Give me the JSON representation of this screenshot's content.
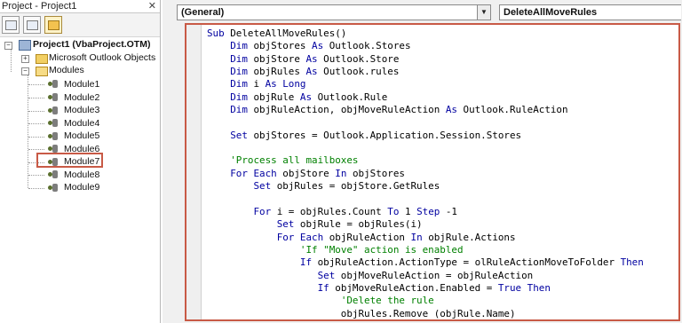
{
  "project_pane": {
    "title": "Project - Project1",
    "close": "✕",
    "toolbar_buttons": [
      "view-code-icon",
      "view-object-icon",
      "toggle-folders-icon"
    ],
    "tree": {
      "project": {
        "toggle": "−",
        "label": "Project1 (VbaProject.OTM)"
      },
      "outlook_objects": {
        "toggle": "+",
        "label": "Microsoft Outlook Objects"
      },
      "modules_folder": {
        "toggle": "−",
        "label": "Modules"
      },
      "modules": [
        "Module1",
        "Module2",
        "Module3",
        "Module4",
        "Module5",
        "Module6",
        "Module7",
        "Module8",
        "Module9"
      ],
      "selected_module": "Module7"
    }
  },
  "code_window": {
    "object_dropdown": "(General)",
    "procedure_dropdown": "DeleteAllMoveRules",
    "lines": [
      [
        [
          "kw",
          "Sub"
        ],
        [
          "t",
          " DeleteAllMoveRules()"
        ]
      ],
      [
        [
          "t",
          "    "
        ],
        [
          "kw",
          "Dim"
        ],
        [
          "t",
          " objStores "
        ],
        [
          "kw",
          "As"
        ],
        [
          "t",
          " Outlook.Stores"
        ]
      ],
      [
        [
          "t",
          "    "
        ],
        [
          "kw",
          "Dim"
        ],
        [
          "t",
          " objStore "
        ],
        [
          "kw",
          "As"
        ],
        [
          "t",
          " Outlook.Store"
        ]
      ],
      [
        [
          "t",
          "    "
        ],
        [
          "kw",
          "Dim"
        ],
        [
          "t",
          " objRules "
        ],
        [
          "kw",
          "As"
        ],
        [
          "t",
          " Outlook.rules"
        ]
      ],
      [
        [
          "t",
          "    "
        ],
        [
          "kw",
          "Dim"
        ],
        [
          "t",
          " i "
        ],
        [
          "kw",
          "As Long"
        ]
      ],
      [
        [
          "t",
          "    "
        ],
        [
          "kw",
          "Dim"
        ],
        [
          "t",
          " objRule "
        ],
        [
          "kw",
          "As"
        ],
        [
          "t",
          " Outlook.Rule"
        ]
      ],
      [
        [
          "t",
          "    "
        ],
        [
          "kw",
          "Dim"
        ],
        [
          "t",
          " objRuleAction, objMoveRuleAction "
        ],
        [
          "kw",
          "As"
        ],
        [
          "t",
          " Outlook.RuleAction"
        ]
      ],
      [
        [
          "t",
          ""
        ]
      ],
      [
        [
          "t",
          "    "
        ],
        [
          "kw",
          "Set"
        ],
        [
          "t",
          " objStores = Outlook.Application.Session.Stores"
        ]
      ],
      [
        [
          "t",
          ""
        ]
      ],
      [
        [
          "t",
          "    "
        ],
        [
          "cm",
          "'Process all mailboxes"
        ]
      ],
      [
        [
          "t",
          "    "
        ],
        [
          "kw",
          "For Each"
        ],
        [
          "t",
          " objStore "
        ],
        [
          "kw",
          "In"
        ],
        [
          "t",
          " objStores"
        ]
      ],
      [
        [
          "t",
          "        "
        ],
        [
          "kw",
          "Set"
        ],
        [
          "t",
          " objRules = objStore.GetRules"
        ]
      ],
      [
        [
          "t",
          ""
        ]
      ],
      [
        [
          "t",
          "        "
        ],
        [
          "kw",
          "For"
        ],
        [
          "t",
          " i = objRules.Count "
        ],
        [
          "kw",
          "To"
        ],
        [
          "t",
          " 1 "
        ],
        [
          "kw",
          "Step"
        ],
        [
          "t",
          " -1"
        ]
      ],
      [
        [
          "t",
          "            "
        ],
        [
          "kw",
          "Set"
        ],
        [
          "t",
          " objRule = objRules(i)"
        ]
      ],
      [
        [
          "t",
          "            "
        ],
        [
          "kw",
          "For Each"
        ],
        [
          "t",
          " objRuleAction "
        ],
        [
          "kw",
          "In"
        ],
        [
          "t",
          " objRule.Actions"
        ]
      ],
      [
        [
          "t",
          "                "
        ],
        [
          "cm",
          "'If \"Move\" action is enabled"
        ]
      ],
      [
        [
          "t",
          "                "
        ],
        [
          "kw",
          "If"
        ],
        [
          "t",
          " objRuleAction.ActionType = olRuleActionMoveToFolder "
        ],
        [
          "kw",
          "Then"
        ]
      ],
      [
        [
          "t",
          "                   "
        ],
        [
          "kw",
          "Set"
        ],
        [
          "t",
          " objMoveRuleAction = objRuleAction"
        ]
      ],
      [
        [
          "t",
          "                   "
        ],
        [
          "kw",
          "If"
        ],
        [
          "t",
          " objMoveRuleAction.Enabled = "
        ],
        [
          "kw",
          "True Then"
        ]
      ],
      [
        [
          "t",
          "                       "
        ],
        [
          "cm",
          "'Delete the rule"
        ]
      ],
      [
        [
          "t",
          "                       objRules.Remove (objRule.Name)"
        ]
      ]
    ]
  }
}
